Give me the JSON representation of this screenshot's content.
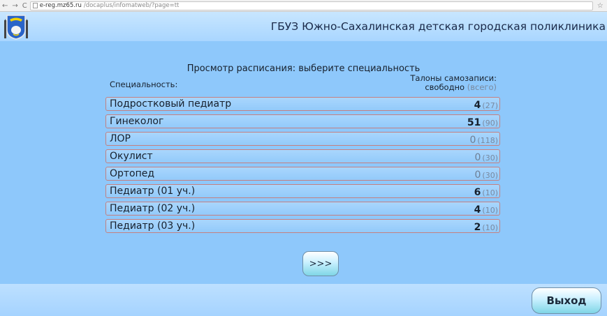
{
  "browser": {
    "url_host": "e-reg.mz65.ru",
    "url_path": "/docaplus/infomatweb/?page=tt"
  },
  "header": {
    "clinic_name": "ГБУЗ Южно-Сахалинская детская городская поликлиника",
    "logo_icon": "sakhalin-coat-of-arms-icon"
  },
  "main": {
    "title": "Просмотр расписания: выберите специальность",
    "col_specialty": "Специальность:",
    "col_tickets_line1": "Талоны самозаписи:",
    "col_tickets_free": "свободно",
    "col_tickets_total": "(всего)"
  },
  "specialties": [
    {
      "name": "Подростковый педиатр",
      "free": "4",
      "total": "(27)"
    },
    {
      "name": "Гинеколог",
      "free": "51",
      "total": "(90)"
    },
    {
      "name": "ЛОР",
      "free": "0",
      "total": "(118)"
    },
    {
      "name": "Окулист",
      "free": "0",
      "total": "(30)"
    },
    {
      "name": "Ортопед",
      "free": "0",
      "total": "(30)"
    },
    {
      "name": "Педиатр (01 уч.)",
      "free": "6",
      "total": "(10)"
    },
    {
      "name": "Педиатр (02 уч.)",
      "free": "4",
      "total": "(10)"
    },
    {
      "name": "Педиатр (03 уч.)",
      "free": "2",
      "total": "(10)"
    }
  ],
  "buttons": {
    "next_label": ">>>",
    "exit_label": "Выход"
  },
  "colors": {
    "background": "#8ec8fb",
    "row_border": "#c48080",
    "muted_text": "#7a8aa0"
  }
}
